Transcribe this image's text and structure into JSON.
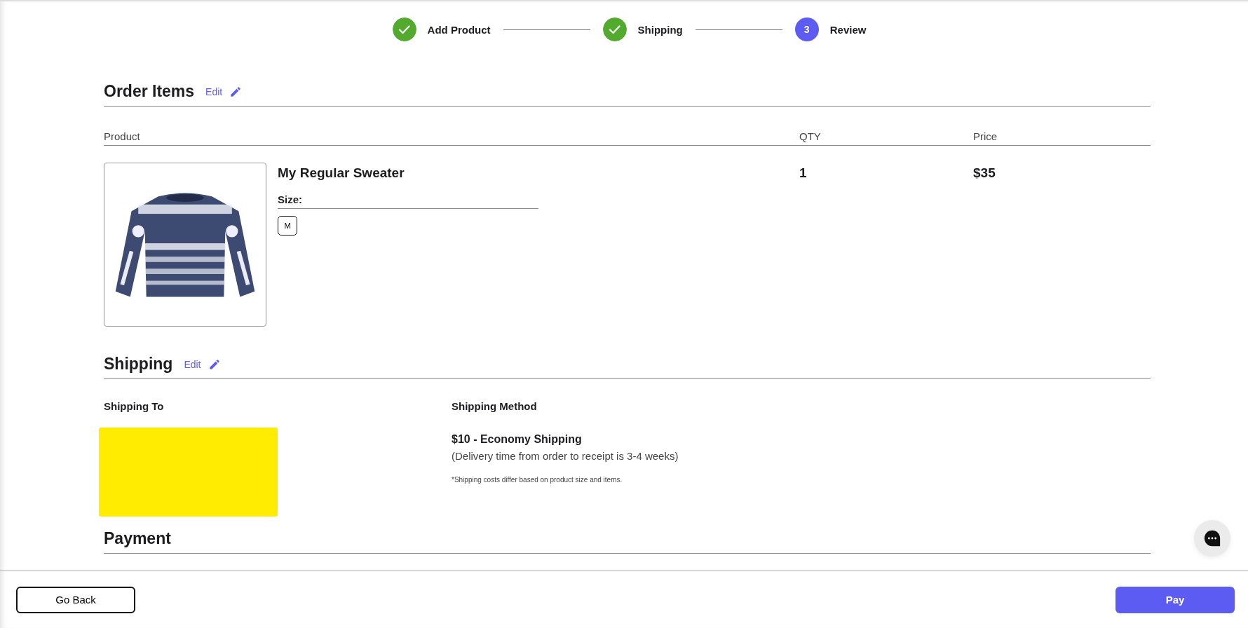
{
  "stepper": [
    {
      "label": "Add Product",
      "completed": true
    },
    {
      "label": "Shipping",
      "completed": true
    },
    {
      "number": "3",
      "label": "Review",
      "completed": false
    }
  ],
  "order_items": {
    "title": "Order Items",
    "edit": "Edit",
    "columns": [
      "Product",
      "QTY",
      "Price"
    ],
    "items": [
      {
        "name": "My Regular Sweater",
        "size_label": "Size:",
        "sizes": [
          {
            "label": "M",
            "selected": true
          }
        ],
        "qty": "1",
        "price": "$35"
      }
    ]
  },
  "shipping": {
    "title": "Shipping",
    "edit": "Edit",
    "to_label": "Shipping To",
    "method_label": "Shipping Method",
    "method": "$10 - Economy Shipping",
    "delivery": "(Delivery time from order to receipt is 3-4 weeks)",
    "note": "*Shipping costs differ based on product size and items."
  },
  "payment": {
    "title": "Payment"
  },
  "footer": {
    "back": "Go Back",
    "pay": "Pay"
  }
}
